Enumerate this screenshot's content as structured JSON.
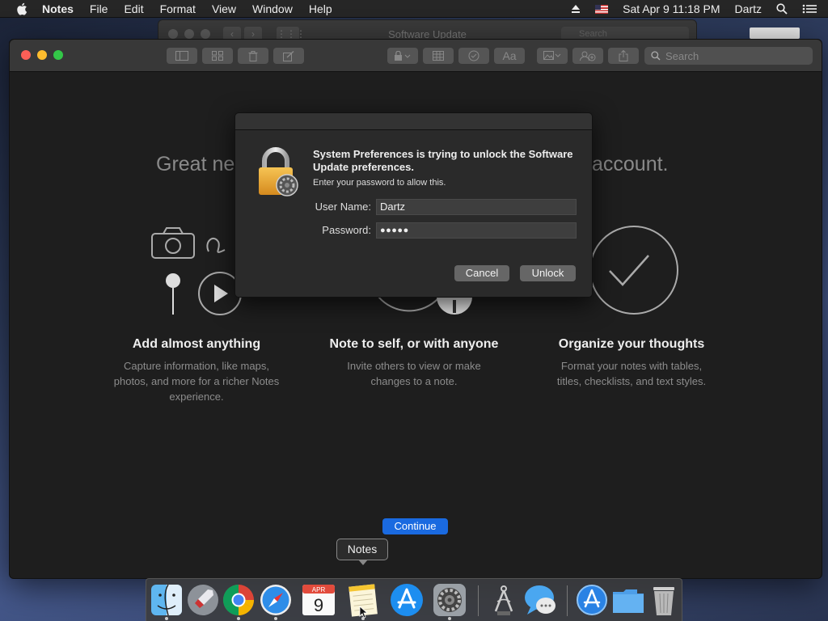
{
  "menubar": {
    "app_name": "Notes",
    "items": [
      "File",
      "Edit",
      "Format",
      "View",
      "Window",
      "Help"
    ],
    "datetime": "Sat Apr 9  11:18 PM",
    "user": "Dartz"
  },
  "bg_window": {
    "title": "Software Update",
    "search_placeholder": "Search"
  },
  "notes": {
    "search_placeholder": "Search",
    "headline_left": "Great ne",
    "headline_right": "account.",
    "features": [
      {
        "title": "Add almost anything",
        "desc": "Capture information, like maps, photos, and more for a richer Notes experience."
      },
      {
        "title": "Note to self, or with anyone",
        "desc": "Invite others to view or make changes to a note."
      },
      {
        "title": "Organize your thoughts",
        "desc": "Format your notes with tables, titles, checklists, and text styles."
      }
    ],
    "continue_label": "Continue"
  },
  "dialog": {
    "message": "System Preferences is trying to unlock the Software Update preferences.",
    "sub": "Enter your password to allow this.",
    "username_label": "User Name:",
    "username_value": "Dartz",
    "password_label": "Password:",
    "password_value": "●●●●●",
    "cancel_label": "Cancel",
    "unlock_label": "Unlock"
  },
  "dock": {
    "tooltip": "Notes",
    "calendar_month": "APR",
    "calendar_day": "9"
  },
  "colors": {
    "accent": "#1a6ae0",
    "close": "#fc5f57",
    "minimize": "#fdbc2e",
    "zoom": "#33c748"
  }
}
